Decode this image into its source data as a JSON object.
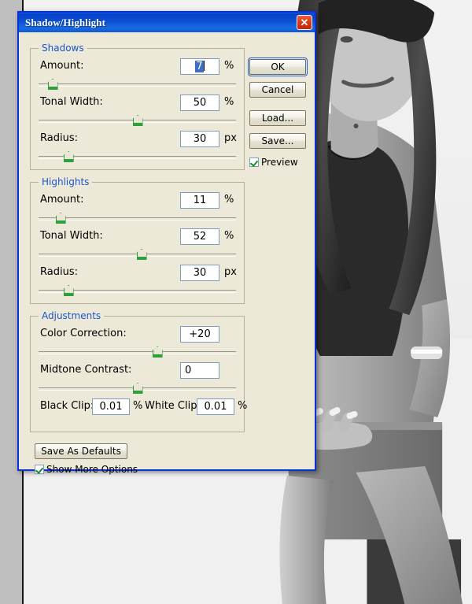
{
  "window": {
    "title": "Shadow/Highlight",
    "close_icon": "close-icon",
    "close_glyph": "✕"
  },
  "groups": {
    "shadows": {
      "legend": "Shadows",
      "fields": [
        {
          "label": "Amount:",
          "value": "7",
          "unit": "%",
          "selected": true,
          "slider_pct": 7
        },
        {
          "label": "Tonal Width:",
          "value": "50",
          "unit": "%",
          "selected": false,
          "slider_pct": 50
        },
        {
          "label": "Radius:",
          "value": "30",
          "unit": "px",
          "selected": false,
          "slider_pct": 15
        }
      ]
    },
    "highlights": {
      "legend": "Highlights",
      "fields": [
        {
          "label": "Amount:",
          "value": "11",
          "unit": "%",
          "selected": false,
          "slider_pct": 11
        },
        {
          "label": "Tonal Width:",
          "value": "52",
          "unit": "%",
          "selected": false,
          "slider_pct": 52
        },
        {
          "label": "Radius:",
          "value": "30",
          "unit": "px",
          "selected": false,
          "slider_pct": 15
        }
      ]
    },
    "adjustments": {
      "legend": "Adjustments",
      "fields": [
        {
          "label": "Color Correction:",
          "value": "+20",
          "unit": "",
          "selected": false,
          "slider_pct": 60
        },
        {
          "label": "Midtone Contrast:",
          "value": "0",
          "unit": "",
          "selected": false,
          "slider_pct": 50
        }
      ],
      "clip": {
        "black_label": "Black Clip:",
        "black_value": "0.01",
        "black_unit": "%",
        "white_label": "White Clip:",
        "white_value": "0.01",
        "white_unit": "%"
      }
    }
  },
  "buttons": {
    "ok": "OK",
    "cancel": "Cancel",
    "load": "Load...",
    "save": "Save...",
    "save_as_defaults": "Save As Defaults"
  },
  "checkboxes": {
    "preview": {
      "label": "Preview",
      "checked": true
    },
    "show_more_options": {
      "label": "Show More Options",
      "checked": true
    }
  },
  "colors": {
    "title_bar": "#0a4ed2",
    "dialog_face": "#ece9d8",
    "group_legend": "#1b54c9",
    "slider_green": "#2f9e3c",
    "field_border": "#7f9db9",
    "selection_blue": "#3c6fc4",
    "close_red": "#d83c18"
  }
}
